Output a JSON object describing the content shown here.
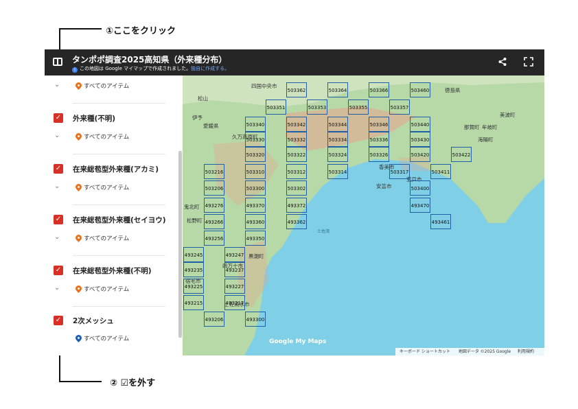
{
  "annotations": {
    "step1": "①ここをクリック",
    "step2": "② ☑を外す"
  },
  "header": {
    "title": "タンポポ調査2025高知県（外来種分布）",
    "subtitle": "この地図は Google マイマップで作成されました。",
    "link": "独自に作成する。"
  },
  "sidebar": {
    "all_items": "すべてのアイテム",
    "layers": [
      {
        "label": "外来種(不明)",
        "pin_color": "#e8711c"
      },
      {
        "label": "在来総苞型外来種(アカミ)",
        "pin_color": "#e8711c"
      },
      {
        "label": "在来総苞型外来種(セイヨウ)",
        "pin_color": "#e8711c"
      },
      {
        "label": "在来総苞型外来種(不明)",
        "pin_color": "#e8711c"
      },
      {
        "label": "2次メッシュ",
        "pin_color": "#1a5fb4"
      }
    ]
  },
  "map": {
    "places": [
      "松山",
      "愛媛県",
      "伊予",
      "久万高原町",
      "四国中央市",
      "徳島県",
      "那賀町",
      "美波町",
      "牟岐町",
      "海陽町",
      "室戸市",
      "土佐湾",
      "鬼北町",
      "松野町",
      "四万十市",
      "黒潮町",
      "宿毛市",
      "土佐清水市",
      "香美市",
      "安芸市"
    ],
    "cells": [
      "503362",
      "503364",
      "503366",
      "503460",
      "503351",
      "503353",
      "503355",
      "503357",
      "503340",
      "503342",
      "503344",
      "503346",
      "503440",
      "503330",
      "503332",
      "503334",
      "503336",
      "503430",
      "503320",
      "503322",
      "503324",
      "503326",
      "503420",
      "503422",
      "503216",
      "503310",
      "503312",
      "503314",
      "503317",
      "503411",
      "503206",
      "503300",
      "503302",
      "503400",
      "493276",
      "493370",
      "493372",
      "493470",
      "493266",
      "493360",
      "493362",
      "493461",
      "493256",
      "493350",
      "493245",
      "493247",
      "493235",
      "493237",
      "493225",
      "493227",
      "493215",
      "493217",
      "493206",
      "493300"
    ],
    "logo": "Google My Maps",
    "attribution": [
      "キーボード ショートカット",
      "地図データ ©2025 Google",
      "利用規約"
    ]
  }
}
